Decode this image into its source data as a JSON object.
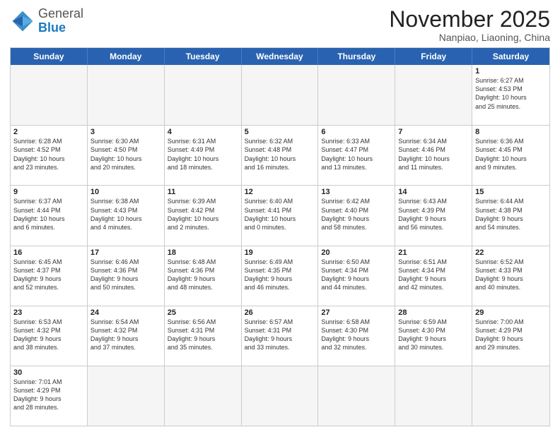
{
  "header": {
    "logo_general": "General",
    "logo_blue": "Blue",
    "month_title": "November 2025",
    "location": "Nanpiao, Liaoning, China"
  },
  "weekdays": [
    "Sunday",
    "Monday",
    "Tuesday",
    "Wednesday",
    "Thursday",
    "Friday",
    "Saturday"
  ],
  "weeks": [
    [
      {
        "day": "",
        "info": "",
        "empty": true
      },
      {
        "day": "",
        "info": "",
        "empty": true
      },
      {
        "day": "",
        "info": "",
        "empty": true
      },
      {
        "day": "",
        "info": "",
        "empty": true
      },
      {
        "day": "",
        "info": "",
        "empty": true
      },
      {
        "day": "",
        "info": "",
        "empty": true
      },
      {
        "day": "1",
        "info": "Sunrise: 6:27 AM\nSunset: 4:53 PM\nDaylight: 10 hours\nand 25 minutes.",
        "empty": false
      }
    ],
    [
      {
        "day": "2",
        "info": "Sunrise: 6:28 AM\nSunset: 4:52 PM\nDaylight: 10 hours\nand 23 minutes.",
        "empty": false
      },
      {
        "day": "3",
        "info": "Sunrise: 6:30 AM\nSunset: 4:50 PM\nDaylight: 10 hours\nand 20 minutes.",
        "empty": false
      },
      {
        "day": "4",
        "info": "Sunrise: 6:31 AM\nSunset: 4:49 PM\nDaylight: 10 hours\nand 18 minutes.",
        "empty": false
      },
      {
        "day": "5",
        "info": "Sunrise: 6:32 AM\nSunset: 4:48 PM\nDaylight: 10 hours\nand 16 minutes.",
        "empty": false
      },
      {
        "day": "6",
        "info": "Sunrise: 6:33 AM\nSunset: 4:47 PM\nDaylight: 10 hours\nand 13 minutes.",
        "empty": false
      },
      {
        "day": "7",
        "info": "Sunrise: 6:34 AM\nSunset: 4:46 PM\nDaylight: 10 hours\nand 11 minutes.",
        "empty": false
      },
      {
        "day": "8",
        "info": "Sunrise: 6:36 AM\nSunset: 4:45 PM\nDaylight: 10 hours\nand 9 minutes.",
        "empty": false
      }
    ],
    [
      {
        "day": "9",
        "info": "Sunrise: 6:37 AM\nSunset: 4:44 PM\nDaylight: 10 hours\nand 6 minutes.",
        "empty": false
      },
      {
        "day": "10",
        "info": "Sunrise: 6:38 AM\nSunset: 4:43 PM\nDaylight: 10 hours\nand 4 minutes.",
        "empty": false
      },
      {
        "day": "11",
        "info": "Sunrise: 6:39 AM\nSunset: 4:42 PM\nDaylight: 10 hours\nand 2 minutes.",
        "empty": false
      },
      {
        "day": "12",
        "info": "Sunrise: 6:40 AM\nSunset: 4:41 PM\nDaylight: 10 hours\nand 0 minutes.",
        "empty": false
      },
      {
        "day": "13",
        "info": "Sunrise: 6:42 AM\nSunset: 4:40 PM\nDaylight: 9 hours\nand 58 minutes.",
        "empty": false
      },
      {
        "day": "14",
        "info": "Sunrise: 6:43 AM\nSunset: 4:39 PM\nDaylight: 9 hours\nand 56 minutes.",
        "empty": false
      },
      {
        "day": "15",
        "info": "Sunrise: 6:44 AM\nSunset: 4:38 PM\nDaylight: 9 hours\nand 54 minutes.",
        "empty": false
      }
    ],
    [
      {
        "day": "16",
        "info": "Sunrise: 6:45 AM\nSunset: 4:37 PM\nDaylight: 9 hours\nand 52 minutes.",
        "empty": false
      },
      {
        "day": "17",
        "info": "Sunrise: 6:46 AM\nSunset: 4:36 PM\nDaylight: 9 hours\nand 50 minutes.",
        "empty": false
      },
      {
        "day": "18",
        "info": "Sunrise: 6:48 AM\nSunset: 4:36 PM\nDaylight: 9 hours\nand 48 minutes.",
        "empty": false
      },
      {
        "day": "19",
        "info": "Sunrise: 6:49 AM\nSunset: 4:35 PM\nDaylight: 9 hours\nand 46 minutes.",
        "empty": false
      },
      {
        "day": "20",
        "info": "Sunrise: 6:50 AM\nSunset: 4:34 PM\nDaylight: 9 hours\nand 44 minutes.",
        "empty": false
      },
      {
        "day": "21",
        "info": "Sunrise: 6:51 AM\nSunset: 4:34 PM\nDaylight: 9 hours\nand 42 minutes.",
        "empty": false
      },
      {
        "day": "22",
        "info": "Sunrise: 6:52 AM\nSunset: 4:33 PM\nDaylight: 9 hours\nand 40 minutes.",
        "empty": false
      }
    ],
    [
      {
        "day": "23",
        "info": "Sunrise: 6:53 AM\nSunset: 4:32 PM\nDaylight: 9 hours\nand 38 minutes.",
        "empty": false
      },
      {
        "day": "24",
        "info": "Sunrise: 6:54 AM\nSunset: 4:32 PM\nDaylight: 9 hours\nand 37 minutes.",
        "empty": false
      },
      {
        "day": "25",
        "info": "Sunrise: 6:56 AM\nSunset: 4:31 PM\nDaylight: 9 hours\nand 35 minutes.",
        "empty": false
      },
      {
        "day": "26",
        "info": "Sunrise: 6:57 AM\nSunset: 4:31 PM\nDaylight: 9 hours\nand 33 minutes.",
        "empty": false
      },
      {
        "day": "27",
        "info": "Sunrise: 6:58 AM\nSunset: 4:30 PM\nDaylight: 9 hours\nand 32 minutes.",
        "empty": false
      },
      {
        "day": "28",
        "info": "Sunrise: 6:59 AM\nSunset: 4:30 PM\nDaylight: 9 hours\nand 30 minutes.",
        "empty": false
      },
      {
        "day": "29",
        "info": "Sunrise: 7:00 AM\nSunset: 4:29 PM\nDaylight: 9 hours\nand 29 minutes.",
        "empty": false
      }
    ],
    [
      {
        "day": "30",
        "info": "Sunrise: 7:01 AM\nSunset: 4:29 PM\nDaylight: 9 hours\nand 28 minutes.",
        "empty": false
      },
      {
        "day": "",
        "info": "",
        "empty": true
      },
      {
        "day": "",
        "info": "",
        "empty": true
      },
      {
        "day": "",
        "info": "",
        "empty": true
      },
      {
        "day": "",
        "info": "",
        "empty": true
      },
      {
        "day": "",
        "info": "",
        "empty": true
      },
      {
        "day": "",
        "info": "",
        "empty": true
      }
    ]
  ]
}
